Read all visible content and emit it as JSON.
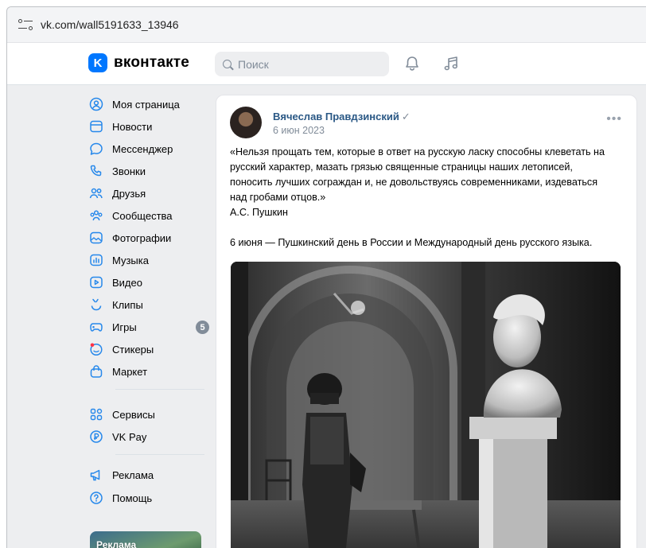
{
  "browser": {
    "url": "vk.com/wall5191633_13946"
  },
  "header": {
    "logo_mark": "K",
    "logo_text": "вконтакте",
    "search_placeholder": "Поиск"
  },
  "sidebar": {
    "items": [
      {
        "label": "Моя страница",
        "icon": "user-circle-icon"
      },
      {
        "label": "Новости",
        "icon": "news-icon"
      },
      {
        "label": "Мессенджер",
        "icon": "message-icon"
      },
      {
        "label": "Звонки",
        "icon": "phone-icon"
      },
      {
        "label": "Друзья",
        "icon": "friends-icon"
      },
      {
        "label": "Сообщества",
        "icon": "communities-icon"
      },
      {
        "label": "Фотографии",
        "icon": "photo-icon"
      },
      {
        "label": "Музыка",
        "icon": "music-icon"
      },
      {
        "label": "Видео",
        "icon": "video-icon"
      },
      {
        "label": "Клипы",
        "icon": "clips-icon"
      },
      {
        "label": "Игры",
        "icon": "games-icon",
        "badge": "5"
      },
      {
        "label": "Стикеры",
        "icon": "stickers-icon"
      },
      {
        "label": "Маркет",
        "icon": "market-icon"
      }
    ],
    "secondary": [
      {
        "label": "Сервисы",
        "icon": "services-icon"
      },
      {
        "label": "VK Pay",
        "icon": "vkpay-icon"
      }
    ],
    "tertiary": [
      {
        "label": "Реклама",
        "icon": "megaphone-icon"
      },
      {
        "label": "Помощь",
        "icon": "help-icon"
      }
    ],
    "ad_label": "Реклама"
  },
  "post": {
    "author": "Вячеслав Правдзинский",
    "verified_mark": "✓",
    "date": "6 июн 2023",
    "more": "•••",
    "text_lines": [
      "«Нельзя прощать тем, которые в ответ на русскую ласку способны клеветать на",
      "русский характер, мазать грязью священные страницы наших летописей,",
      "поносить лучших сограждан и, не довольствуясь современниками, издеваться",
      "над гробами отцов.»",
      "А.С. Пушкин"
    ],
    "text_after": "6 июня — Пушкинский день в России и Международный день русского языка."
  },
  "colors": {
    "accent": "#0077ff",
    "link": "#2a5885",
    "muted": "#818c99",
    "background": "#edeef0"
  }
}
